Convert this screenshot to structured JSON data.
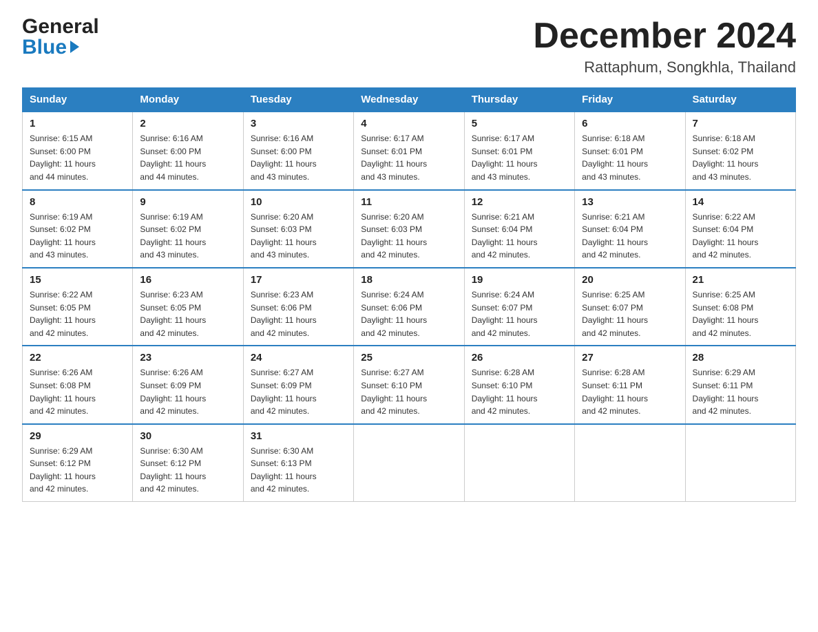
{
  "logo": {
    "line1": "General",
    "line2": "Blue"
  },
  "title": "December 2024",
  "location": "Rattaphum, Songkhla, Thailand",
  "days_of_week": [
    "Sunday",
    "Monday",
    "Tuesday",
    "Wednesday",
    "Thursday",
    "Friday",
    "Saturday"
  ],
  "weeks": [
    [
      {
        "day": "1",
        "sunrise": "6:15 AM",
        "sunset": "6:00 PM",
        "daylight": "11 hours and 44 minutes."
      },
      {
        "day": "2",
        "sunrise": "6:16 AM",
        "sunset": "6:00 PM",
        "daylight": "11 hours and 44 minutes."
      },
      {
        "day": "3",
        "sunrise": "6:16 AM",
        "sunset": "6:00 PM",
        "daylight": "11 hours and 43 minutes."
      },
      {
        "day": "4",
        "sunrise": "6:17 AM",
        "sunset": "6:01 PM",
        "daylight": "11 hours and 43 minutes."
      },
      {
        "day": "5",
        "sunrise": "6:17 AM",
        "sunset": "6:01 PM",
        "daylight": "11 hours and 43 minutes."
      },
      {
        "day": "6",
        "sunrise": "6:18 AM",
        "sunset": "6:01 PM",
        "daylight": "11 hours and 43 minutes."
      },
      {
        "day": "7",
        "sunrise": "6:18 AM",
        "sunset": "6:02 PM",
        "daylight": "11 hours and 43 minutes."
      }
    ],
    [
      {
        "day": "8",
        "sunrise": "6:19 AM",
        "sunset": "6:02 PM",
        "daylight": "11 hours and 43 minutes."
      },
      {
        "day": "9",
        "sunrise": "6:19 AM",
        "sunset": "6:02 PM",
        "daylight": "11 hours and 43 minutes."
      },
      {
        "day": "10",
        "sunrise": "6:20 AM",
        "sunset": "6:03 PM",
        "daylight": "11 hours and 43 minutes."
      },
      {
        "day": "11",
        "sunrise": "6:20 AM",
        "sunset": "6:03 PM",
        "daylight": "11 hours and 42 minutes."
      },
      {
        "day": "12",
        "sunrise": "6:21 AM",
        "sunset": "6:04 PM",
        "daylight": "11 hours and 42 minutes."
      },
      {
        "day": "13",
        "sunrise": "6:21 AM",
        "sunset": "6:04 PM",
        "daylight": "11 hours and 42 minutes."
      },
      {
        "day": "14",
        "sunrise": "6:22 AM",
        "sunset": "6:04 PM",
        "daylight": "11 hours and 42 minutes."
      }
    ],
    [
      {
        "day": "15",
        "sunrise": "6:22 AM",
        "sunset": "6:05 PM",
        "daylight": "11 hours and 42 minutes."
      },
      {
        "day": "16",
        "sunrise": "6:23 AM",
        "sunset": "6:05 PM",
        "daylight": "11 hours and 42 minutes."
      },
      {
        "day": "17",
        "sunrise": "6:23 AM",
        "sunset": "6:06 PM",
        "daylight": "11 hours and 42 minutes."
      },
      {
        "day": "18",
        "sunrise": "6:24 AM",
        "sunset": "6:06 PM",
        "daylight": "11 hours and 42 minutes."
      },
      {
        "day": "19",
        "sunrise": "6:24 AM",
        "sunset": "6:07 PM",
        "daylight": "11 hours and 42 minutes."
      },
      {
        "day": "20",
        "sunrise": "6:25 AM",
        "sunset": "6:07 PM",
        "daylight": "11 hours and 42 minutes."
      },
      {
        "day": "21",
        "sunrise": "6:25 AM",
        "sunset": "6:08 PM",
        "daylight": "11 hours and 42 minutes."
      }
    ],
    [
      {
        "day": "22",
        "sunrise": "6:26 AM",
        "sunset": "6:08 PM",
        "daylight": "11 hours and 42 minutes."
      },
      {
        "day": "23",
        "sunrise": "6:26 AM",
        "sunset": "6:09 PM",
        "daylight": "11 hours and 42 minutes."
      },
      {
        "day": "24",
        "sunrise": "6:27 AM",
        "sunset": "6:09 PM",
        "daylight": "11 hours and 42 minutes."
      },
      {
        "day": "25",
        "sunrise": "6:27 AM",
        "sunset": "6:10 PM",
        "daylight": "11 hours and 42 minutes."
      },
      {
        "day": "26",
        "sunrise": "6:28 AM",
        "sunset": "6:10 PM",
        "daylight": "11 hours and 42 minutes."
      },
      {
        "day": "27",
        "sunrise": "6:28 AM",
        "sunset": "6:11 PM",
        "daylight": "11 hours and 42 minutes."
      },
      {
        "day": "28",
        "sunrise": "6:29 AM",
        "sunset": "6:11 PM",
        "daylight": "11 hours and 42 minutes."
      }
    ],
    [
      {
        "day": "29",
        "sunrise": "6:29 AM",
        "sunset": "6:12 PM",
        "daylight": "11 hours and 42 minutes."
      },
      {
        "day": "30",
        "sunrise": "6:30 AM",
        "sunset": "6:12 PM",
        "daylight": "11 hours and 42 minutes."
      },
      {
        "day": "31",
        "sunrise": "6:30 AM",
        "sunset": "6:13 PM",
        "daylight": "11 hours and 42 minutes."
      },
      null,
      null,
      null,
      null
    ]
  ],
  "labels": {
    "sunrise": "Sunrise:",
    "sunset": "Sunset:",
    "daylight": "Daylight:"
  }
}
